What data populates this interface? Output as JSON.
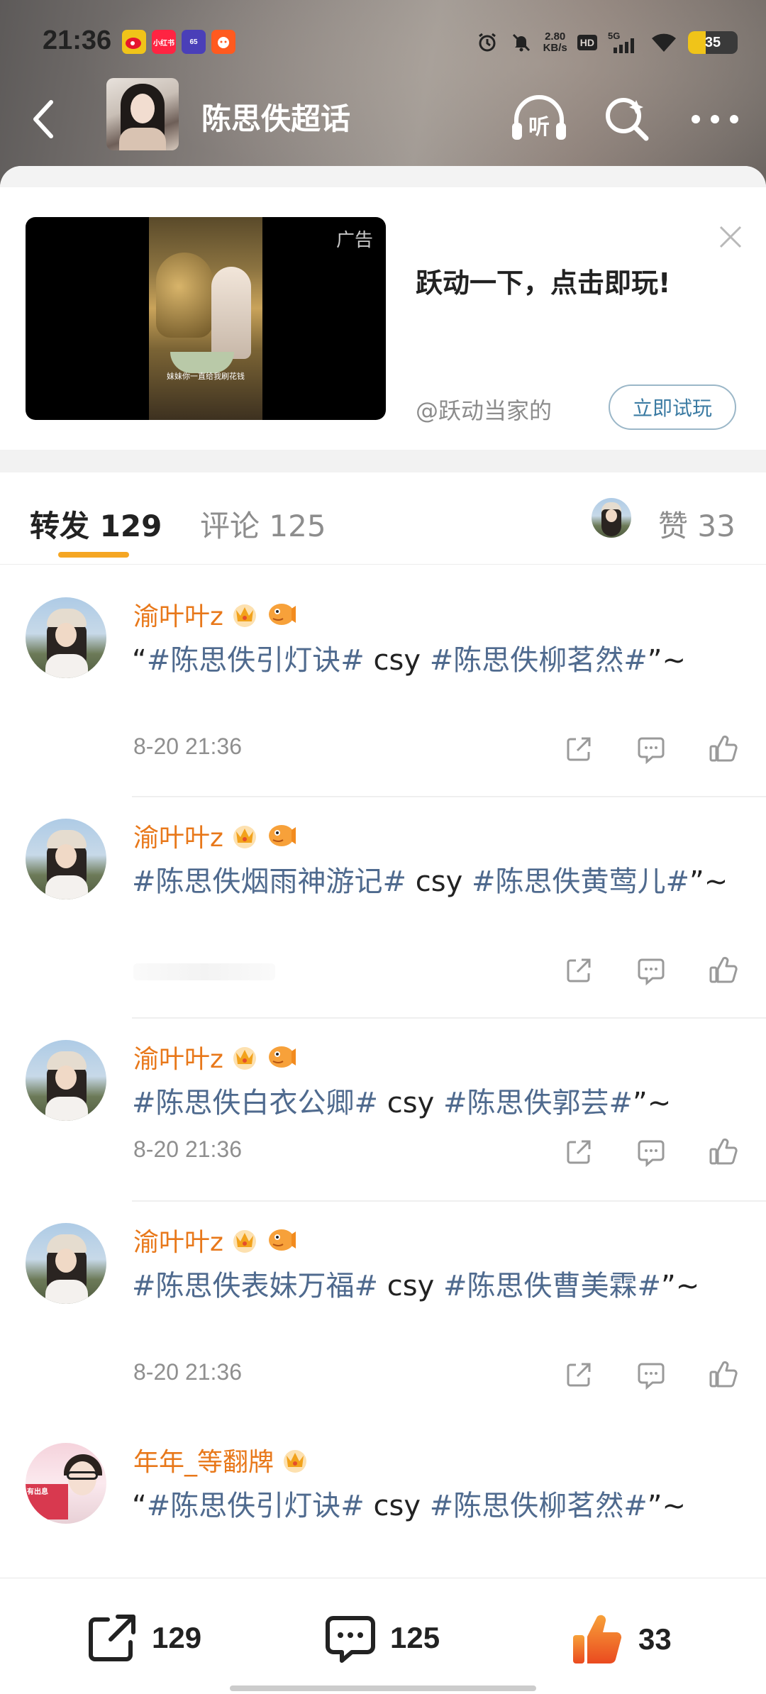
{
  "status_bar": {
    "time": "21:36",
    "net_speed_value": "2.80",
    "net_speed_unit": "KB/s",
    "hd": "HD",
    "signal": "5G",
    "battery": "35",
    "battery_level": 0.35,
    "app_icons": [
      "weibo-icon",
      "xiaohongshu-icon",
      "app-icon",
      "taobao-icon"
    ]
  },
  "nav": {
    "title": "陈思佚超话"
  },
  "ad": {
    "label": "广告",
    "title": "跃动一下，点击即玩!",
    "author": "@跃动当家的",
    "cta": "立即试玩",
    "poster_caption": "妹妹你一直给我刷花钱"
  },
  "tabs": {
    "repost_label": "转发",
    "repost_count": "129",
    "comment_label": "评论",
    "comment_count": "125",
    "like_label": "赞",
    "like_count": "33"
  },
  "reposts": [
    {
      "user": "渝叶叶z",
      "quote_open": "“",
      "tag1": "#陈思佚引灯诀#",
      "mid": " csy ",
      "tag2": "#陈思佚柳茗然#",
      "tail": "”~",
      "time": "8-20 21:36"
    },
    {
      "user": "渝叶叶z",
      "quote_open": "",
      "tag1": "#陈思佚烟雨神游记#",
      "mid": " csy ",
      "tag2": "#陈思佚黄莺儿#",
      "tail": "”~",
      "time": ""
    },
    {
      "user": "渝叶叶z",
      "quote_open": "",
      "tag1": "#陈思佚白衣公卿#",
      "mid": " csy ",
      "tag2": "#陈思佚郭芸#",
      "tail": "”~",
      "time": "8-20 21:36"
    },
    {
      "user": "渝叶叶z",
      "quote_open": "",
      "tag1": "#陈思佚表妹万福#",
      "mid": " csy ",
      "tag2": "#陈思佚曹美霖#",
      "tail": "”~",
      "time": "8-20 21:36"
    },
    {
      "user": "年年_等翻牌",
      "quote_open": "“",
      "tag1": "#陈思佚引灯诀#",
      "mid": " csy ",
      "tag2": "#陈思佚柳茗然#",
      "tail": "”~",
      "time": ""
    }
  ],
  "avatar2_text": "有出息",
  "bottom_bar": {
    "repost_count": "129",
    "comment_count": "125",
    "like_count": "33"
  },
  "colors": {
    "username": "#e8781a",
    "hashtag": "#4f6a8e",
    "tab_indicator": "#f5a623",
    "like_active": "#f07a1e"
  }
}
